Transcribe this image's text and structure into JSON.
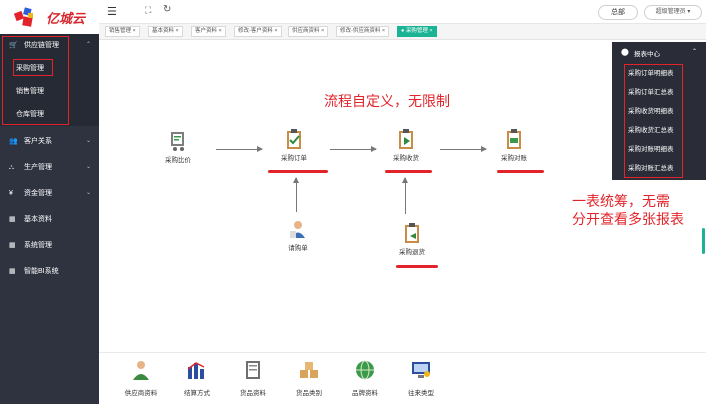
{
  "brand": {
    "name": "亿城云"
  },
  "sidebar": {
    "group": {
      "label": "供应链管理",
      "items": [
        "采购管理",
        "销售管理",
        "仓库管理"
      ]
    },
    "menu": [
      {
        "label": "客户关系"
      },
      {
        "label": "生产管理"
      },
      {
        "label": "资金管理"
      },
      {
        "label": "基本资料"
      },
      {
        "label": "系统管理"
      },
      {
        "label": "智能BI系统"
      }
    ]
  },
  "header": {
    "org_button": "总部",
    "user_button": "超级管理员"
  },
  "tabs": [
    "销售管理",
    "基本资料",
    "客户资料",
    "修改-客户资料",
    "供应商资料",
    "修改-供应商资料",
    "采购管理"
  ],
  "report_panel": {
    "title": "报表中心",
    "items": [
      "采购订单明细表",
      "采购订单汇总表",
      "采购收货明细表",
      "采购收货汇总表",
      "采购对账明细表",
      "采购对账汇总表"
    ]
  },
  "flow": {
    "nodes": {
      "compare": "采购比价",
      "order": "采购订单",
      "receive": "采购收货",
      "reconcile": "采购对账",
      "request": "请购单",
      "return": "采购退货"
    },
    "annotation_top": "流程自定义，无限制",
    "annotation_right_1": "一表统筹，无需",
    "annotation_right_2": "分开查看多张报表"
  },
  "bottom_links": [
    "供应商资料",
    "结算方式",
    "货品资料",
    "货品类别",
    "品牌资料",
    "往来类型"
  ],
  "colors": {
    "accent": "#1ab394",
    "highlight": "#e2242a",
    "sidebar": "#2f3340"
  }
}
